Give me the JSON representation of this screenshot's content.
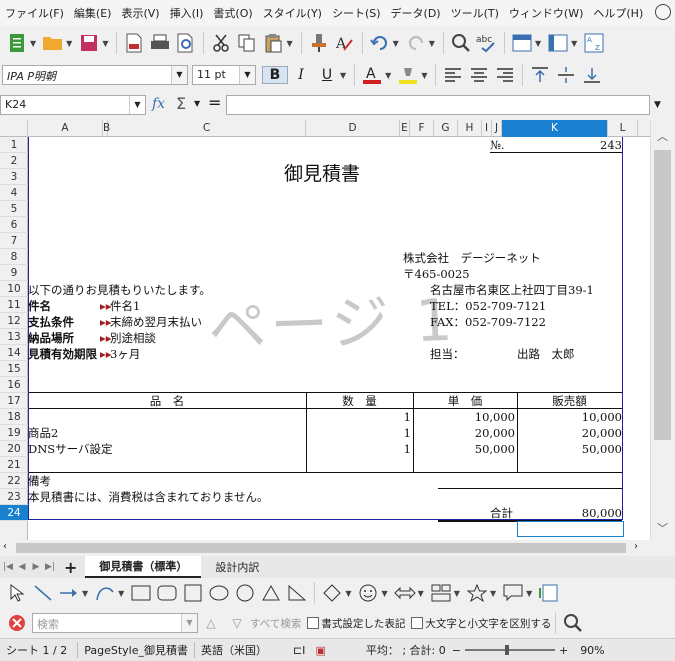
{
  "menu": [
    "ファイル(F)",
    "編集(E)",
    "表示(V)",
    "挿入(I)",
    "書式(O)",
    "スタイル(Y)",
    "シート(S)",
    "データ(D)",
    "ツール(T)",
    "ウィンドウ(W)",
    "ヘルプ(H)"
  ],
  "format_bar": {
    "font_name": "IPA P明朝",
    "font_size": "11 pt",
    "bold": "B",
    "italic": "I",
    "underline": "U"
  },
  "formula_bar": {
    "cell_ref": "K24",
    "fx": "fx",
    "sigma": "Σ",
    "equals": "=",
    "content": ""
  },
  "columns": [
    {
      "label": "A"
    },
    {
      "label": "B"
    },
    {
      "label": "C"
    },
    {
      "label": "D"
    },
    {
      "label": "E"
    },
    {
      "label": "F"
    },
    {
      "label": "G"
    },
    {
      "label": "H"
    },
    {
      "label": "I"
    },
    {
      "label": "J"
    },
    {
      "label": "K",
      "selected": true
    },
    {
      "label": "L"
    }
  ],
  "rows": [
    "1",
    "2",
    "3",
    "4",
    "5",
    "6",
    "7",
    "8",
    "9",
    "10",
    "11",
    "12",
    "13",
    "14",
    "15",
    "16",
    "17",
    "18",
    "19",
    "20",
    "21",
    "22",
    "23",
    "24"
  ],
  "selected_row": "24",
  "sheet": {
    "no_label": "№.",
    "no_value": "243",
    "title": "御見積書",
    "company": "株式会社　デージーネット",
    "postal": "〒465-0025",
    "address": "名古屋市名東区上社四丁目39-1",
    "tel": "TEL：052-709-7121",
    "fax": "FAX：052-709-7122",
    "intro": "以下の通りお見積もりいたします。",
    "fields": [
      {
        "label": "件名",
        "value": "件名1"
      },
      {
        "label": "支払条件",
        "value": "末締め翌月末払い"
      },
      {
        "label": "納品場所",
        "value": "別途相談"
      },
      {
        "label": "見積有効期限",
        "value": "3ヶ月"
      }
    ],
    "staff_label": "担当：",
    "staff_name": "出路　太郎",
    "table_headers": {
      "item": "品　名",
      "qty": "数　量",
      "unit": "単　価",
      "amount": "販売額"
    },
    "items": [
      {
        "name": "",
        "qty": "1",
        "unit": "10,000",
        "amount": "10,000"
      },
      {
        "name": "商品2",
        "qty": "1",
        "unit": "20,000",
        "amount": "20,000"
      },
      {
        "name": "DNSサーバ設定",
        "qty": "1",
        "unit": "50,000",
        "amount": "50,000"
      }
    ],
    "remarks_label": "備考",
    "remarks_text": "本見積書には、消費税は含まれておりません。",
    "total_label": "合計",
    "total_value": "80,000",
    "watermark": "ページ 1"
  },
  "tabs": {
    "active": "御見積書（標準）",
    "other": "設計内訳"
  },
  "find": {
    "placeholder": "検索",
    "find_all": "すべて検索",
    "formatted": "書式設定した表記",
    "match_case": "大文字と小文字を区別する"
  },
  "status": {
    "sheet": "シート 1 / 2",
    "page_style": "PageStyle_御見積書",
    "language": "英語（米国）",
    "sum": "平均： ; 合計: 0",
    "zoom": "90%"
  },
  "colors": {
    "selection": "#1a80d0",
    "print_border": "#2020a0"
  }
}
